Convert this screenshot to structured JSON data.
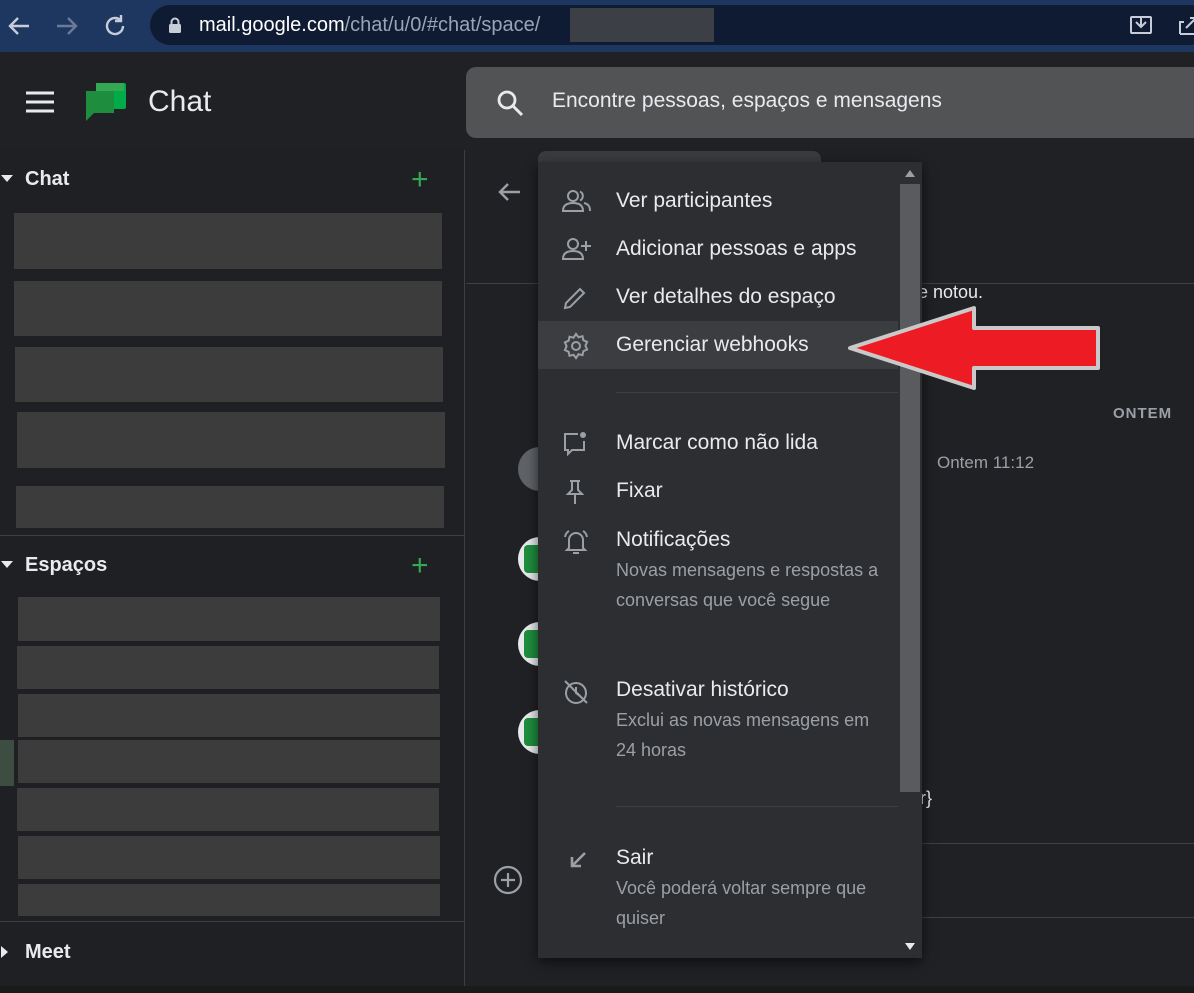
{
  "browser": {
    "url_host": "mail.google.com",
    "url_path": "/chat/u/0/#chat/space/"
  },
  "header": {
    "app_title": "Chat",
    "search_placeholder": "Encontre pessoas, espaços e mensagens"
  },
  "sidebar": {
    "chat_section": {
      "label": "Chat"
    },
    "spaces_section": {
      "label": "Espaços"
    },
    "meet_section": {
      "label": "Meet"
    }
  },
  "main": {
    "message_fragment_1": "e notou.",
    "date_separator": "ONTEM",
    "message_time": "Ontem 11:12",
    "message_fragment_2": "r}"
  },
  "menu": {
    "items": [
      {
        "label": "Ver participantes",
        "icon": "people-icon"
      },
      {
        "label": "Adicionar pessoas e apps",
        "icon": "person-add-icon"
      },
      {
        "label": "Ver detalhes do espaço",
        "icon": "pencil-icon"
      },
      {
        "label": "Gerenciar webhooks",
        "icon": "gear-icon"
      },
      {
        "label": "Marcar como não lida",
        "icon": "mark-unread-icon"
      },
      {
        "label": "Fixar",
        "icon": "pin-icon"
      },
      {
        "label": "Notificações",
        "sub": "Novas mensagens e respostas a conversas que você segue",
        "icon": "bell-icon"
      },
      {
        "label": "Desativar histórico",
        "sub": "Exclui as novas mensagens em 24 horas",
        "icon": "history-off-icon"
      },
      {
        "label": "Sair",
        "sub": "Você poderá voltar sempre que quiser",
        "icon": "exit-arrow-icon"
      }
    ]
  },
  "colors": {
    "browser_bar": "#1e3760",
    "accent_green": "#34a853",
    "annotation_arrow": "#ed1c24"
  }
}
